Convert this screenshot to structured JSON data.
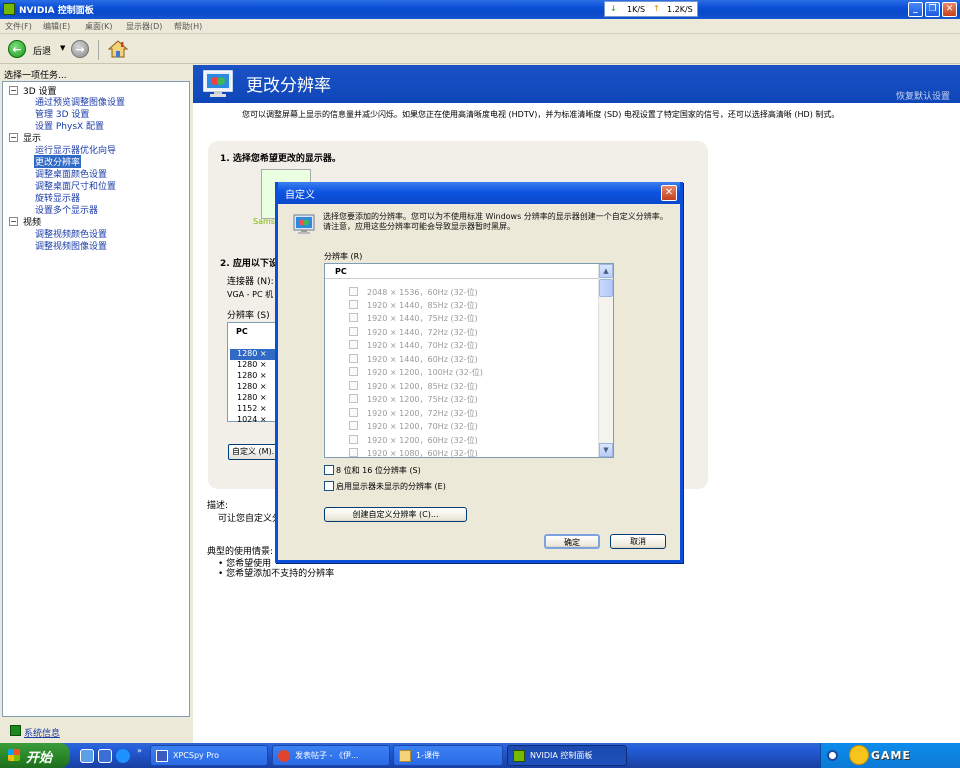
{
  "window": {
    "title": "NVIDIA 控制面板",
    "net_down": "1K/S",
    "net_up": "1.2K/S"
  },
  "menu": [
    "文件(F)",
    "编辑(E)",
    "桌面(K)",
    "显示器(D)",
    "帮助(H)"
  ],
  "toolbar": {
    "back_label": "后退"
  },
  "left": {
    "header": "选择一项任务...",
    "tree": [
      {
        "kind": "group",
        "label": "3D 设置",
        "expander": "−"
      },
      {
        "kind": "link",
        "label": "通过预览调整图像设置"
      },
      {
        "kind": "link",
        "label": "管理 3D 设置"
      },
      {
        "kind": "link",
        "label": "设置 PhysX 配置"
      },
      {
        "kind": "group",
        "label": "显示",
        "expander": "−"
      },
      {
        "kind": "link",
        "label": "运行显示器优化向导"
      },
      {
        "kind": "selected",
        "label": "更改分辨率"
      },
      {
        "kind": "link",
        "label": "调整桌面颜色设置"
      },
      {
        "kind": "link",
        "label": "调整桌面尺寸和位置"
      },
      {
        "kind": "link",
        "label": "旋转显示器"
      },
      {
        "kind": "link",
        "label": "设置多个显示器"
      },
      {
        "kind": "group",
        "label": "视频",
        "expander": "−"
      },
      {
        "kind": "link",
        "label": "调整视频颜色设置"
      },
      {
        "kind": "link",
        "label": "调整视频图像设置"
      }
    ],
    "system_info": "系统信息"
  },
  "page": {
    "title": "更改分辨率",
    "restore_defaults": "恢复默认设置",
    "intro": "您可以调整屏幕上显示的信息量并减少闪烁。如果您正在使用高清晰度电视 (HDTV)，并为标准清晰度 (SD) 电视设置了特定国家的信号，还可以选择高清晰 (HD) 制式。",
    "step1": "1. 选择您希望更改的显示器。",
    "monitor_label": "Samsu",
    "step2": "2. 应用以下设",
    "connector_label": "连接器 (N):",
    "connector_value": "VGA - PC 机",
    "resolution_label": "分辨率 (S)",
    "res_list_header": "PC",
    "res_list": [
      "1280 ×",
      "1280 ×",
      "1280 ×",
      "1280 ×",
      "1280 ×",
      "1152 ×",
      "1024 ×"
    ],
    "custom_button": "自定义 (M)...",
    "description_label": "描述:",
    "description_text": "可让您自定义分",
    "usage_label": "典型的使用情景:",
    "usage_items": [
      "• 您希望使用",
      "• 您希望添加不支持的分辨率"
    ]
  },
  "dialog": {
    "title": "自定义",
    "message": "选择您要添加的分辨率。您可以为不使用标准 Windows 分辨率的显示器创建一个自定义分辨率。请注意，应用这些分辨率可能会导致显示器暂时黑屏。",
    "resolution_label": "分辨率 (R)",
    "list_header": "PC",
    "resolutions": [
      "2048 × 1536，60Hz (32-位)",
      "1920 × 1440，85Hz (32-位)",
      "1920 × 1440，75Hz (32-位)",
      "1920 × 1440，72Hz (32-位)",
      "1920 × 1440，70Hz (32-位)",
      "1920 × 1440，60Hz (32-位)",
      "1920 × 1200，100Hz (32-位)",
      "1920 × 1200，85Hz (32-位)",
      "1920 × 1200，75Hz (32-位)",
      "1920 × 1200，72Hz (32-位)",
      "1920 × 1200，70Hz (32-位)",
      "1920 × 1200，60Hz (32-位)",
      "1920 × 1080，60Hz (32-位)"
    ],
    "checkbox_8_16": "8 位和 16 位分辨率 (S)",
    "checkbox_unsupported": "启用显示器未显示的分辨率 (E)",
    "create_button": "创建自定义分辨率 (C)...",
    "ok_button": "确定",
    "cancel_button": "取消"
  },
  "taskbar": {
    "start_label": "开始",
    "tasks": [
      {
        "label": "XPCSpy Pro",
        "active": false
      },
      {
        "label": "发表帖子 - 《伊...",
        "active": false
      },
      {
        "label": "1-课件",
        "active": false
      },
      {
        "label": "NVIDIA 控制面板",
        "active": true
      }
    ],
    "tray_brand": "GAME"
  },
  "colors": {
    "title_blue": "#0a49c8",
    "nvidia_green": "#76b900",
    "selection_blue": "#316ac5",
    "xp_start_green": "#2a8a2a"
  }
}
